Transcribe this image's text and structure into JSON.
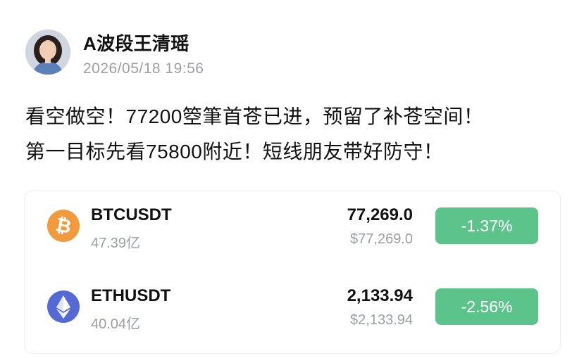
{
  "post": {
    "author": "A波段王清瑶",
    "time": "2026/05/18 19:56",
    "lines": [
      "看空做空！77200箜筆首苍已进，预留了补苍空间！",
      "第一目标先看75800附近！短线朋友带好防守！"
    ]
  },
  "tickers": [
    {
      "icon": "bitcoin-icon",
      "symbol": "BTCUSDT",
      "volume": "47.39亿",
      "price": "77,269.0",
      "price_usd": "$77,269.0",
      "change": "-1.37%",
      "change_color": "#5cc48b",
      "icon_color": "#f19a3e"
    },
    {
      "icon": "ethereum-icon",
      "symbol": "ETHUSDT",
      "volume": "40.04亿",
      "price": "2,133.94",
      "price_usd": "$2,133.94",
      "change": "-2.56%",
      "change_color": "#5cc48b",
      "icon_color": "#5469d4"
    }
  ]
}
